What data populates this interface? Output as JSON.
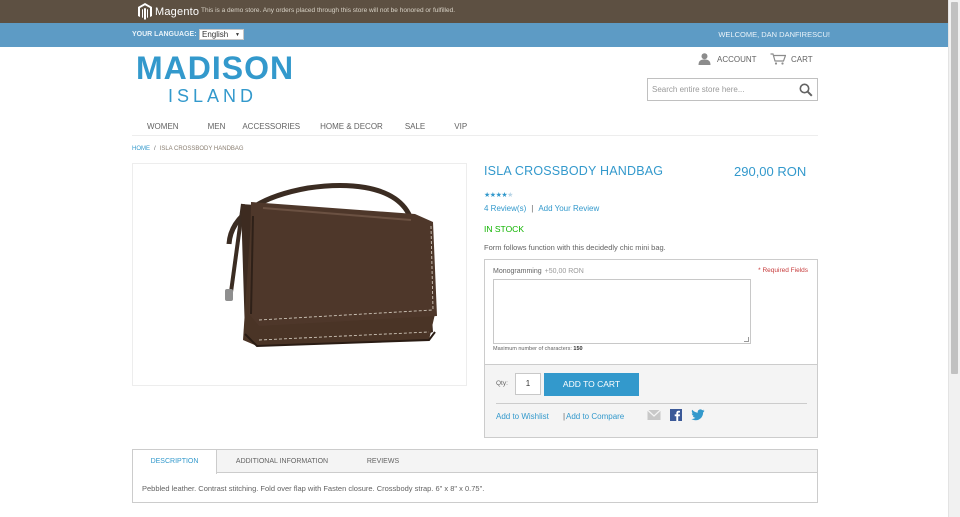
{
  "demo_bar": {
    "logo_text": "Magento",
    "notice": "This is a demo store. Any orders placed through this store will not be honored or fulfilled."
  },
  "header": {
    "language_label": "YOUR LANGUAGE:",
    "language_value": "English",
    "welcome": "WELCOME, DAN DANFIRESCU!",
    "brand_line1": "MADISON",
    "brand_line2": "ISLAND",
    "account_label": "ACCOUNT",
    "cart_label": "CART",
    "search_placeholder": "Search entire store here..."
  },
  "nav": {
    "items": [
      "WOMEN",
      "MEN",
      "ACCESSORIES",
      "HOME & DECOR",
      "SALE",
      "VIP"
    ]
  },
  "breadcrumb": {
    "home": "HOME",
    "separator": "/",
    "current": "ISLA CROSSBODY HANDBAG"
  },
  "product": {
    "name": "ISLA CROSSBODY HANDBAG",
    "price": "290,00 RON",
    "rating_stars": 4.5,
    "rating_max": 5,
    "reviews_link": "4 Review(s)",
    "reviews_separator": "|",
    "add_review_link": "Add Your Review",
    "stock": "IN STOCK",
    "short_description": "Form follows function with this decidedly chic mini bag."
  },
  "options": {
    "label": "Monogramming",
    "price_delta": "+50,00 RON",
    "required_note": "* Required Fields",
    "max_chars_label": "Maximum number of characters:",
    "max_chars_value": "150"
  },
  "cart_form": {
    "qty_label": "Qty:",
    "qty_value": "1",
    "add_to_cart": "ADD TO CART",
    "wishlist": "Add to Wishlist",
    "compare_separator": "|",
    "compare": "Add to Compare",
    "share_icons": [
      "email-icon",
      "facebook-icon",
      "twitter-icon"
    ]
  },
  "tabs": {
    "items": [
      "DESCRIPTION",
      "ADDITIONAL INFORMATION",
      "REVIEWS"
    ],
    "active": 0,
    "content": "Pebbled leather. Contrast stitching. Fold over flap with Fasten closure. Crossbody strap. 6\" x 8\" x 0.75\"."
  },
  "colors": {
    "accent": "#3399cc",
    "demo_bar": "#5d5042",
    "blue_strip": "#5d9bc5",
    "in_stock": "#11b400"
  }
}
